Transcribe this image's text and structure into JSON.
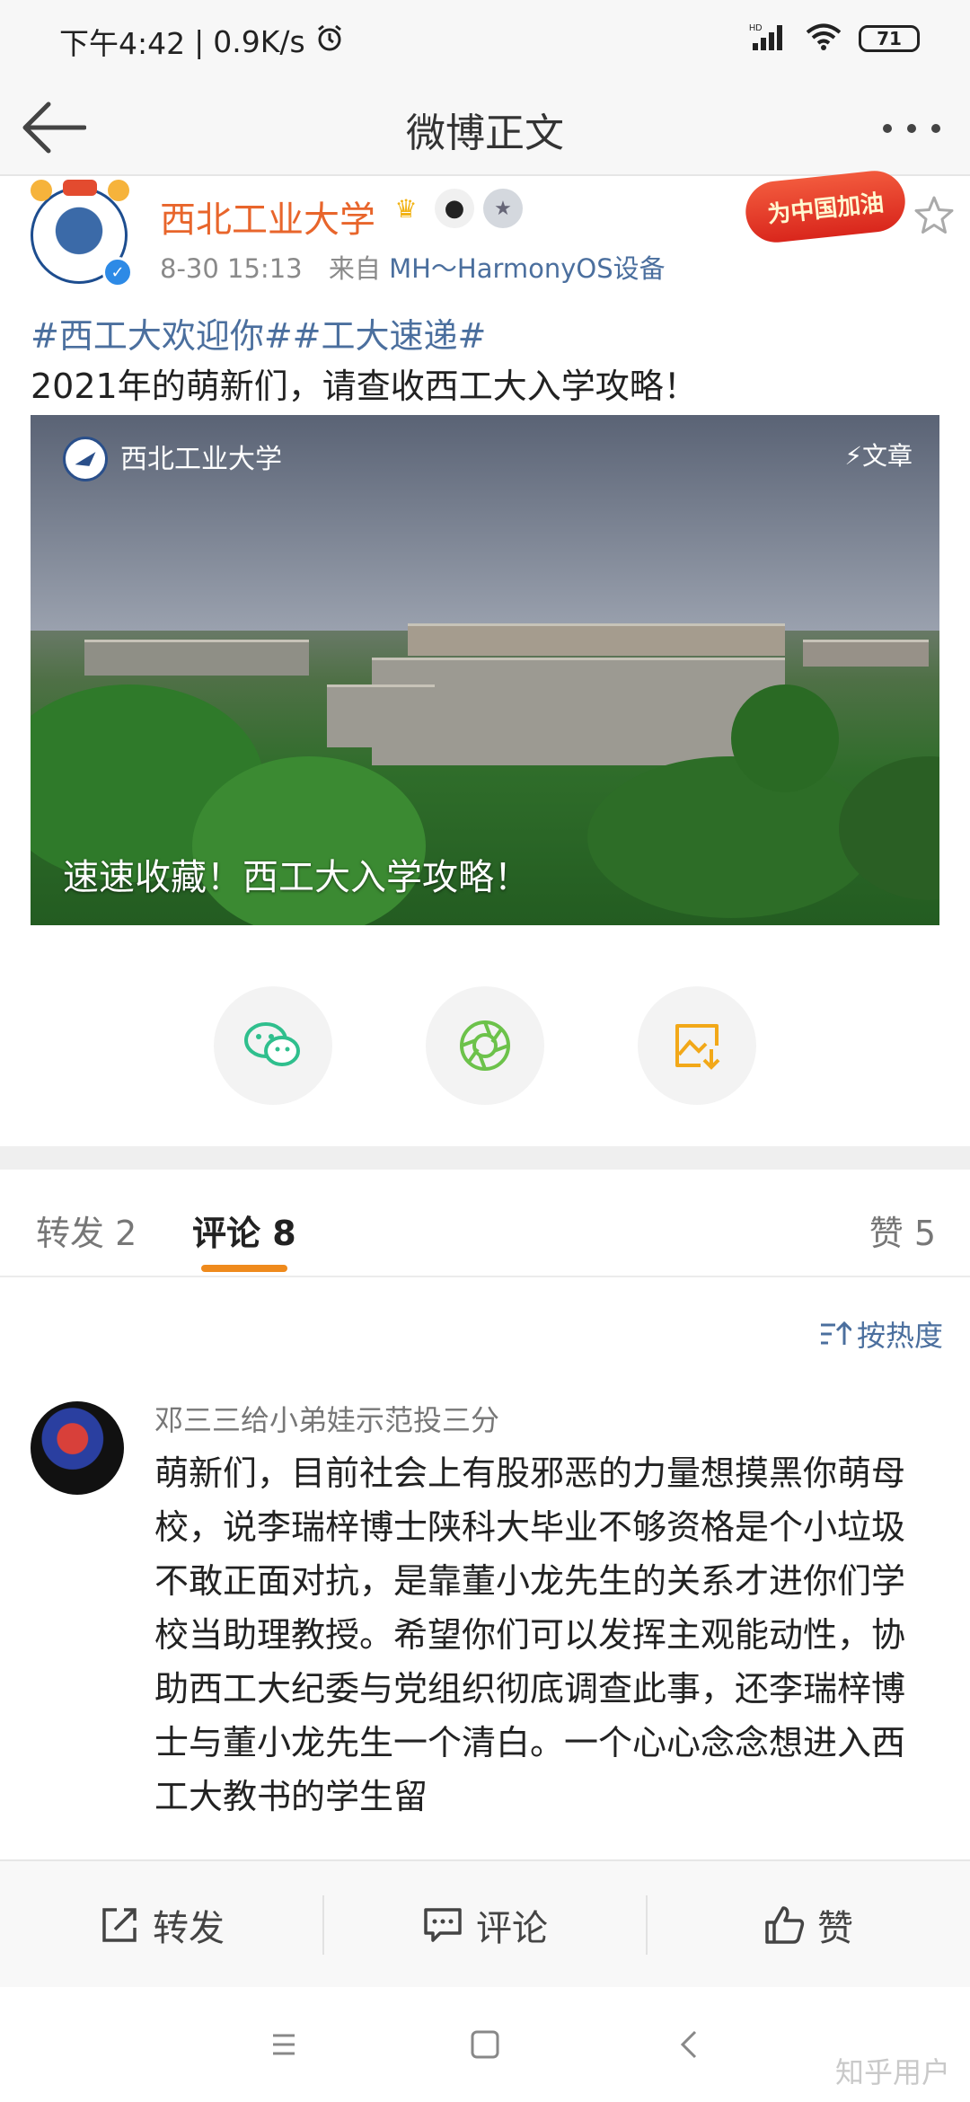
{
  "status_bar": {
    "time": "下午4:42",
    "speed": "0.9K/s",
    "network": "HD",
    "battery": "71"
  },
  "header": {
    "title": "微博正文"
  },
  "post": {
    "author": "西北工业大学",
    "promo_badge": "为中国加油",
    "date": "8-30 15:13",
    "source_prefix": "来自",
    "source": "MH～HarmonyOS设备",
    "hashtags": "#西工大欢迎你##工大速递#",
    "text": "2021年的萌新们，请查收西工大入学攻略！"
  },
  "article_card": {
    "source_name": "西北工业大学",
    "type_label": "文章",
    "caption": "速速收藏！西工大入学攻略！"
  },
  "share": {
    "wechat_icon": "wechat-icon",
    "moments_icon": "moments-icon",
    "save_image_icon": "save-image-icon",
    "colors": {
      "wechat": "#2fbf8d",
      "moments": "#6cc24a",
      "save": "#f2a818"
    }
  },
  "tabs": {
    "repost": "转发 2",
    "comment": "评论 8",
    "like": "赞 5"
  },
  "sort": {
    "label": "按热度"
  },
  "comment": {
    "user": "邓三三给小弟娃示范投三分",
    "text": "萌新们，目前社会上有股邪恶的力量想摸黑你萌母校，说李瑞梓博士陕科大毕业不够资格是个小垃圾不敢正面对抗，是靠董小龙先生的关系才进你们学校当助理教授。希望你们可以发挥主观能动性，协助西工大纪委与党组织彻底调查此事，还李瑞梓博士与董小龙先生一个清白。一个心心念念想进入西工大教书的学生留"
  },
  "action_bar": {
    "repost": "转发",
    "comment": "评论",
    "like": "赞"
  },
  "watermark": "知乎用户",
  "colors": {
    "accent": "#ef8a1c",
    "link": "#4b6f9e",
    "author": "#e8652b"
  }
}
